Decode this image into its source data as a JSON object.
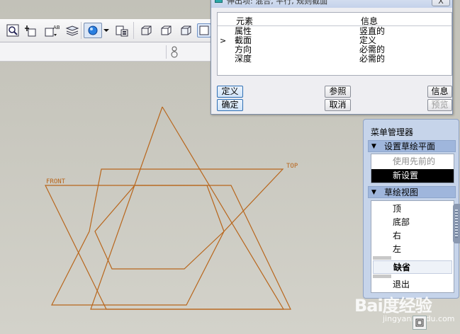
{
  "dialog": {
    "title": "伸出项: 混合, 平行, 规则截面",
    "close_label": "X",
    "columns": [
      "元素",
      "信息"
    ],
    "rows": [
      {
        "element": "属性",
        "info": "竖直的",
        "current": false
      },
      {
        "element": "截面",
        "info": "定义",
        "current": true
      },
      {
        "element": "方向",
        "info": "必需的",
        "current": false
      },
      {
        "element": "深度",
        "info": "必需的",
        "current": false
      }
    ],
    "current_marker": ">",
    "buttons": {
      "define": "定义",
      "refs": "参照",
      "info": "信息",
      "ok": "确定",
      "cancel": "取消",
      "preview": "预览"
    }
  },
  "menu_manager": {
    "title": "菜单管理器",
    "section1": {
      "label": "设置草绘平面",
      "items": [
        {
          "label": "使用先前的",
          "state": "disabled"
        },
        {
          "label": "新设置",
          "state": "selected"
        }
      ]
    },
    "section2": {
      "label": "草绘视图",
      "items": [
        {
          "label": "顶",
          "state": "normal"
        },
        {
          "label": "底部",
          "state": "normal"
        },
        {
          "label": "右",
          "state": "normal"
        },
        {
          "label": "左",
          "state": "normal"
        },
        {
          "label": "缺省",
          "state": "hover"
        },
        {
          "label": "退出",
          "state": "normal"
        }
      ]
    }
  },
  "viewport": {
    "datum_front": "FRONT",
    "datum_top": "TOP"
  },
  "watermark": {
    "brand": "Bai度经验",
    "url": "jingyan.baidu.com"
  },
  "colors": {
    "datum": "#b8661c",
    "menu_bg": "#c6d4ea",
    "selected_bg": "#000000"
  }
}
